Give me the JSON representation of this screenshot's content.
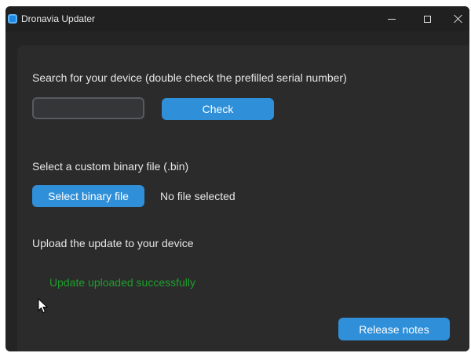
{
  "window": {
    "title": "Dronavia Updater",
    "app_icon": "app-icon",
    "controls": [
      "minimize-icon",
      "maximize-icon",
      "close-icon"
    ]
  },
  "search": {
    "label": "Search for your device (double check the prefilled serial number)",
    "serial_value": "",
    "check_label": "Check"
  },
  "binary": {
    "label": "Select a custom binary file (.bin)",
    "button_label": "Select binary file",
    "status": "No file selected"
  },
  "upload": {
    "label": "Upload the update to your device",
    "status": "Update uploaded successfully"
  },
  "footer": {
    "release_notes_label": "Release notes"
  },
  "colors": {
    "accent": "#2f8fd8",
    "success": "#1f9e2c",
    "background": "#242424",
    "panel": "#2b2b2b"
  }
}
